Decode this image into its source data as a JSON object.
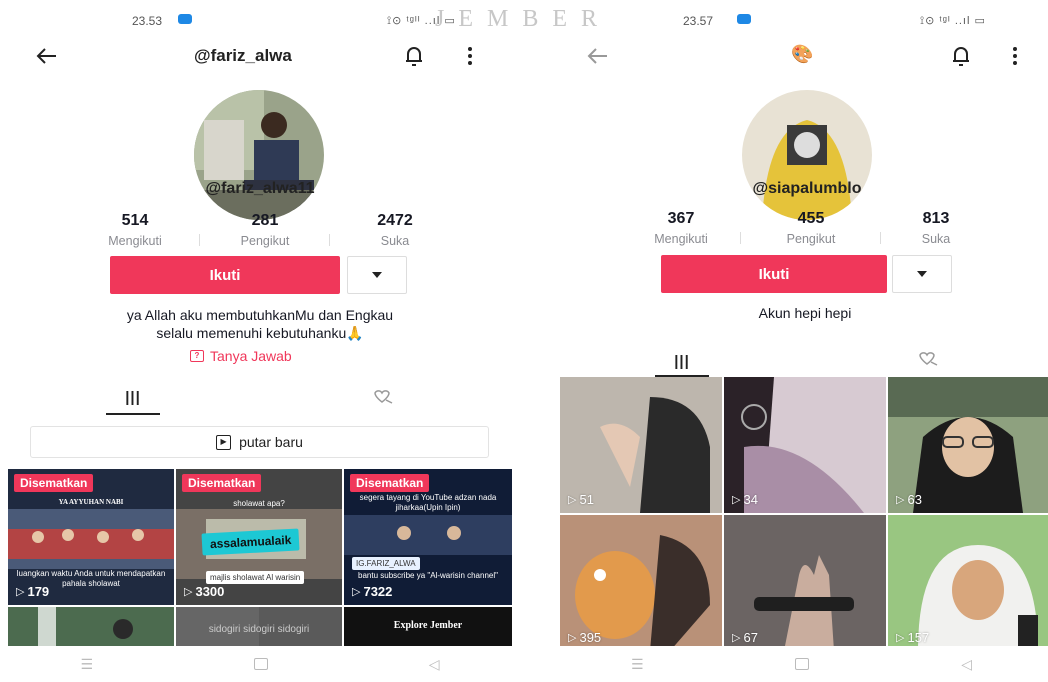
{
  "watermark": "JEMBER",
  "left": {
    "status": {
      "time": "23.53",
      "signal": "⟟⊙ ᵗᵍᴵᴵ ..ıl ▭"
    },
    "header": {
      "title": "@fariz_alwa"
    },
    "handle": "@fariz_alwa11",
    "stats": [
      {
        "num": "514",
        "label": "Mengikuti"
      },
      {
        "num": "281",
        "label": "Pengikut"
      },
      {
        "num": "2472",
        "label": "Suka"
      }
    ],
    "follow_label": "Ikuti",
    "bio_line1": "ya Allah aku membutuhkanMu dan Engkau",
    "bio_line2": "selalu memenuhi kebutuhanku🙏",
    "qa_label": "Tanya Jawab",
    "tab_grid_glyph": "|||",
    "playlist_label": "putar baru",
    "videos": [
      {
        "pinned": "Disematkan",
        "title": "YA AYYUHAN NABI",
        "caption": "luangkan waktu Anda untuk mendapatkan pahala sholawat",
        "views": "179"
      },
      {
        "pinned": "Disematkan",
        "title": "sholawat apa?",
        "tag": "assalamualaik",
        "caption": "majlis sholawat Al warisin",
        "views": "3300"
      },
      {
        "pinned": "Disematkan",
        "title": "segera tayang di YouTube adzan nada jiharkaa(Upin Ipin)",
        "caption": "bantu subscribe ya \"Al-warisin channel\"",
        "tagline": "IG.FARIZ_ALWA",
        "views": "7322"
      },
      {
        "caption": ""
      },
      {
        "caption": "sidogiri sidogiri sidogiri"
      },
      {
        "caption": "Explore Jember"
      }
    ]
  },
  "right": {
    "status": {
      "time": "23.57",
      "signal": "⟟⊙ ᵗᵍᴵ ..ıl ▭"
    },
    "header": {
      "title": "🎨"
    },
    "handle": "@siapalumblo",
    "stats": [
      {
        "num": "367",
        "label": "Mengikuti"
      },
      {
        "num": "455",
        "label": "Pengikut"
      },
      {
        "num": "813",
        "label": "Suka"
      }
    ],
    "follow_label": "Ikuti",
    "bio": "Akun hepi hepi",
    "tab_grid_glyph": "|||",
    "videos": [
      {
        "views": "51"
      },
      {
        "views": "34"
      },
      {
        "views": "63"
      },
      {
        "views": "395"
      },
      {
        "views": "67"
      },
      {
        "views": "157"
      }
    ]
  },
  "colors": {
    "accent": "#f0375a",
    "text": "#161823",
    "muted": "#8a8b91"
  },
  "icons": [
    "back-arrow-icon",
    "bell-icon",
    "more-vertical-icon",
    "dropdown-caret-icon",
    "grid-icon",
    "liked-heart-icon",
    "question-icon",
    "playlist-icon",
    "play-icon"
  ]
}
